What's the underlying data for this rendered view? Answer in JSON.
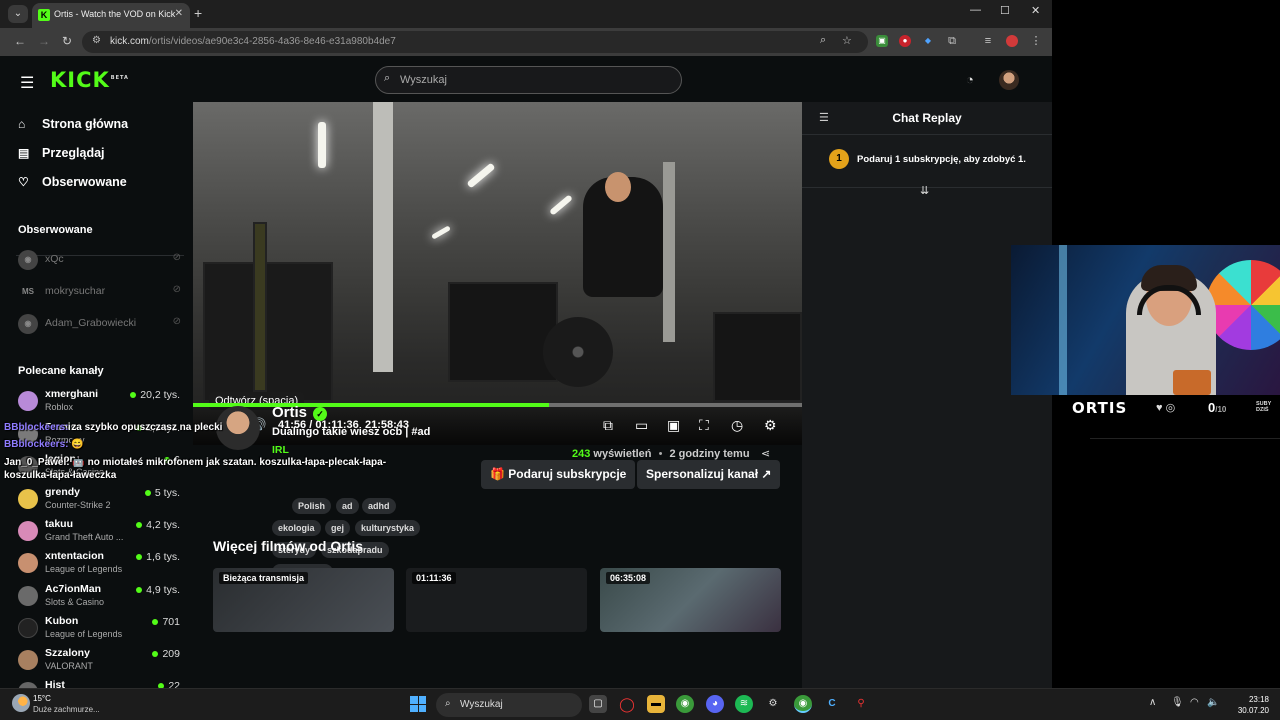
{
  "browser": {
    "tab_title": "Ortis - Watch the VOD on Kick",
    "url_host": "kick.com",
    "url_path": "/ortis/videos/ae90e3c4-2856-4a36-8e46-e31a980b4de7"
  },
  "site": {
    "logo": "KICK",
    "logo_badge": "BETA",
    "search_placeholder": "Wyszukaj"
  },
  "sidebar": {
    "nav": [
      {
        "label": "Strona główna",
        "icon": "home-icon"
      },
      {
        "label": "Przeglądaj",
        "icon": "browse-icon"
      },
      {
        "label": "Obserwowane",
        "icon": "heart-icon"
      }
    ],
    "followed_heading": "Obserwowane",
    "followed": [
      {
        "name": "xQc",
        "avatar": "",
        "offline": true
      },
      {
        "name": "mokrysuchar",
        "avatar": "MS",
        "offline": true
      },
      {
        "name": "Adam_Grabowiecki",
        "avatar": "",
        "offline": true
      }
    ],
    "recommended_heading": "Polecane kanały",
    "channels": [
      {
        "name": "xmerghani",
        "category": "Roblox",
        "viewers": "20,2 tys.",
        "color": "#b88ad8"
      },
      {
        "name": "Franio",
        "category": "Rozmowy",
        "viewers": "2,9 tys.",
        "color": "#7a7a7a"
      },
      {
        "name": "legion",
        "category": "Slots & Casino",
        "viewers": "6",
        "color": "#555"
      },
      {
        "name": "grendy",
        "category": "Counter-Strike 2",
        "viewers": "5 tys.",
        "color": "#e8c24a"
      },
      {
        "name": "takuu",
        "category": "Grand Theft Auto ...",
        "viewers": "4,2 tys.",
        "color": "#d88ab8"
      },
      {
        "name": "xntentacion",
        "category": "League of Legends",
        "viewers": "1,6 tys.",
        "color": "#c89070"
      },
      {
        "name": "Ac7ionMan",
        "category": "Slots & Casino",
        "viewers": "4,9 tys.",
        "color": "#6a6a6a"
      },
      {
        "name": "Kubon",
        "category": "League of Legends",
        "viewers": "701",
        "color": "#222"
      },
      {
        "name": "Szzalony",
        "category": "VALORANT",
        "viewers": "209",
        "color": "#a88060"
      },
      {
        "name": "Hist",
        "category": "",
        "viewers": "22",
        "color": "#666"
      }
    ]
  },
  "player": {
    "tooltip": "Odtwórz (spacja)",
    "current_time": "41:56",
    "duration": "01:11:36",
    "clock_time": "21:58:43",
    "progress_fraction": 0.585
  },
  "video_info": {
    "channel_name": "Ortis",
    "title": "Dualingo takie wiesz ocb | #ad",
    "category": "IRL",
    "tags_row1": [
      "Polish",
      "ad",
      "adhd"
    ],
    "tags_row2": [
      "ekologia",
      "gej",
      "kulturystyka"
    ],
    "tags_row3": [
      "sterydy",
      "szkodapradu"
    ],
    "tags_row4": [
      "testosteron"
    ],
    "subscribe_button": "Podaruj subskrypcje",
    "customize_button": "Spersonalizuj kanał",
    "views_count": "243",
    "views_label": "wyświetleń",
    "separator": "•",
    "time_ago": "2 godziny temu"
  },
  "more_videos": {
    "heading": "Więcej filmów od Ortis",
    "items": [
      {
        "label": "Bieżąca transmisja"
      },
      {
        "label": "01:11:36"
      },
      {
        "label": "06:35:08"
      }
    ]
  },
  "chat": {
    "title": "Chat Replay",
    "promo_badge": "1",
    "promo_text": "Podaruj 1 subskrypcję, aby zdobyć 1."
  },
  "overlay": {
    "name": "ORTIS",
    "count": "0",
    "count_max": "/10",
    "sub_label_1": "SUBY",
    "sub_label_2": "DZIŚ",
    "chat_lines": [
      {
        "user": "BBblockeers:",
        "text": "za szybko opuszczasz na plecki"
      },
      {
        "user": "BBblockeers:",
        "text": ""
      },
      {
        "user": "Jan_0_Pawel:",
        "text": "no miotałeś mikrofonem jak szatan. koszulka-łapa-plecak-łapa-"
      },
      {
        "user": "",
        "text": "koszulka-łapa-ławeczka"
      }
    ]
  },
  "taskbar": {
    "temp": "15°C",
    "weather": "Duże zachmurze...",
    "search": "Wyszukaj",
    "time": "23:18",
    "date": "30.07.20"
  }
}
